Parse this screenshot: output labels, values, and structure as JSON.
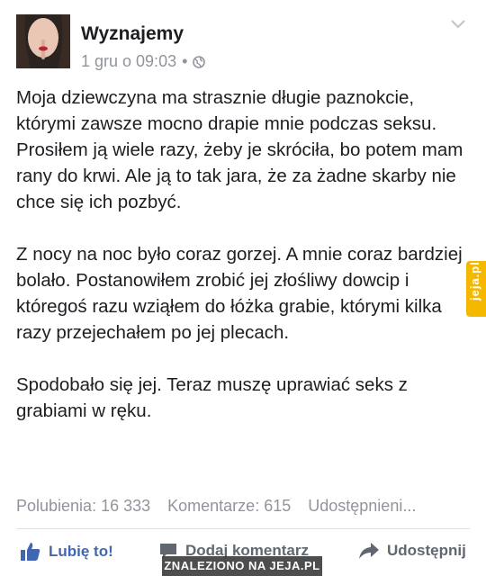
{
  "post": {
    "author": "Wyznajemy",
    "date": "1 gru o 09:03",
    "separator": "•",
    "paragraphs": [
      "Moja dziewczyna ma strasznie długie paznokcie, którymi zawsze mocno drapie mnie podczas seksu. Prosiłem ją wiele razy, żeby je skróciła, bo potem mam rany do krwi. Ale ją to tak jara, że za żadne skarby nie chce się ich pozbyć.",
      "Z nocy na noc było coraz gorzej. A mnie coraz bardziej bolało. Postanowiłem zrobić jej złośliwy dowcip i któregoś razu wziąłem do łóżka grabie, którymi kilka razy przejechałem po jej plecach.",
      "Spodobało się jej. Teraz muszę uprawiać seks z grabiami w ręku."
    ]
  },
  "stats": {
    "likes": "Polubienia: 16 333",
    "comments": "Komentarze: 615",
    "shares": "Udostępnieni..."
  },
  "actions": {
    "like": "Lubię to!",
    "comment": "Dodaj komentarz",
    "share": "Udostępnij"
  },
  "branding": {
    "side_logo": "jeja.pl",
    "watermark": "ZNALEZIONO NA JEJA.PL"
  },
  "icons": {
    "globe": "globe-icon",
    "chevron": "chevron-down-icon",
    "like": "thumbs-up-icon",
    "comment": "comment-icon",
    "share": "share-arrow-icon"
  },
  "colors": {
    "like_blue": "#4267b2",
    "muted": "#90949c",
    "side_logo": "#f5b800"
  }
}
